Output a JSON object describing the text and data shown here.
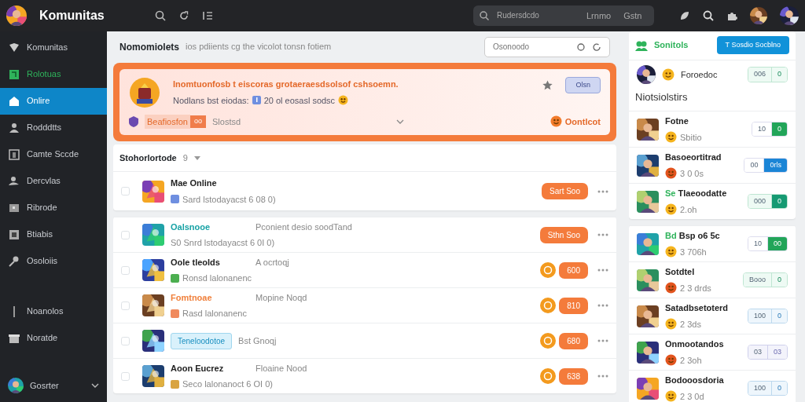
{
  "topbar": {
    "brand": "Komunitas",
    "search": {
      "placeholder": "Rudersdcdo",
      "hints": [
        "Lrnmo",
        "Gstn"
      ]
    }
  },
  "sidebar": {
    "items": [
      {
        "label": "Komunitas",
        "selected": false,
        "highlight": false
      },
      {
        "label": "Rolotuas",
        "selected": false,
        "highlight": true
      },
      {
        "label": "Onlire",
        "selected": true,
        "highlight": false
      },
      {
        "label": "Rodddtts",
        "selected": false,
        "highlight": false
      },
      {
        "label": "Camte Sccde",
        "selected": false,
        "highlight": false
      },
      {
        "label": "Dercvlas",
        "selected": false,
        "highlight": false
      },
      {
        "label": "Ribrode",
        "selected": false,
        "highlight": false
      },
      {
        "label": "Btiabis",
        "selected": false,
        "highlight": false
      },
      {
        "label": "Osoloiis",
        "selected": false,
        "highlight": false
      }
    ],
    "secondary_items": [
      {
        "label": "Noanolos",
        "selected": false
      },
      {
        "label": "Noratde",
        "selected": false
      }
    ],
    "user": "Gosrter"
  },
  "header": {
    "title": "Nomomiolets",
    "subtitle": "ios pdiients cg the vicolot tonsn fotiem",
    "search": {
      "placeholder": "Osonoodo"
    }
  },
  "banner": {
    "title": "Inomtuonfosb t eiscoras grotaeraesdsolsof cshsoemn.",
    "meta": "Nodlans bst eiodas:",
    "detail": "20 ol eosasl sodsc",
    "button": "Olsn",
    "tag": "Beafiosfon",
    "tag_badge": "oo",
    "status": "Slostsd",
    "link": "Oontlcot"
  },
  "list": {
    "title": "Stohorlortode",
    "count": "9",
    "rows": [
      {
        "name": "Mae Online",
        "kind": "plain",
        "subtitle": "Sard lstodayacst 6 08 0)",
        "color": "#6f8fe0",
        "checked": false,
        "action": {
          "kind": "button",
          "label": "Sart Soo"
        }
      },
      {
        "name": "Oalsnooe",
        "kind": "teal",
        "extra": "Pconient desio soodTand",
        "subtitle": "S0 Snrd lstodayacst 6 0I 0)",
        "checked": false,
        "action": {
          "kind": "button",
          "label": "Sthn Soo"
        }
      },
      {
        "name": "Oole tleolds",
        "kind": "plain",
        "extra": "A ocrtoqj",
        "subtitle": "Ronsd lalonanenc",
        "color": "#4caf50",
        "checked": false,
        "action": {
          "kind": "pair",
          "label": "600"
        }
      },
      {
        "name": "Fomtnoae",
        "kind": "orange",
        "extra": "Mopine Noqd",
        "subtitle": "Rasd lalonanenc",
        "color": "#f08a5d",
        "checked": false,
        "action": {
          "kind": "pair",
          "label": "810"
        }
      },
      {
        "name": "Teneloodotoe",
        "kind": "tag",
        "extra": "Bst Gnoqj",
        "checked": false,
        "action": {
          "kind": "pair",
          "label": "680"
        }
      },
      {
        "name": "Aoon Eucrez",
        "kind": "plain",
        "extra": "Floaine Nood",
        "subtitle": "Seco lalonanoct 6 OI 0)",
        "color": "#d9a441",
        "checked": false,
        "action": {
          "kind": "pair",
          "label": "638"
        }
      }
    ]
  },
  "panel": {
    "title": "Sonitols",
    "button": "T Sosdio Socblno",
    "featured": {
      "name": "Foroedoc",
      "count": "006",
      "action": "0",
      "kind": "mint"
    },
    "section": "Niotsiolstirs",
    "groups": [
      [
        {
          "name": "Fotne",
          "sub": "Sbitio",
          "count": "10",
          "action": "0",
          "kind": "green"
        },
        {
          "name": "Basoeortitrad",
          "sub": "3 0 0s",
          "count": "00",
          "action": "0rls",
          "kind": "blue"
        },
        {
          "prefix": "Se",
          "name": "Tlaeoodatte",
          "sub": "2.oh",
          "count": "000",
          "action": "0",
          "kind": "teal"
        }
      ],
      [
        {
          "prefix": "Bd",
          "name": "Bsp o6 5c",
          "sub": "3 706h",
          "count": "10",
          "action": "00",
          "kind": "green"
        },
        {
          "name": "Sotdtel",
          "sub": "2 3 drds",
          "count": "Booo",
          "action": "0",
          "kind": "mint"
        },
        {
          "name": "Satadbsetoterd",
          "sub": "2 3ds",
          "count": "100",
          "action": "0",
          "kind": "sky"
        },
        {
          "name": "Onmootandos",
          "sub": "2 3oh",
          "count": "03",
          "action": "03",
          "kind": "lilac"
        },
        {
          "name": "Bodooosdoria",
          "sub": "2 3 0d",
          "count": "100",
          "action": "0",
          "kind": "sky"
        }
      ]
    ]
  }
}
